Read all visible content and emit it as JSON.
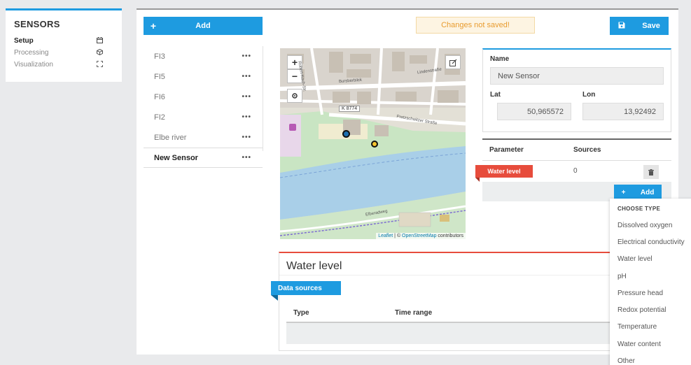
{
  "nav": {
    "title": "SENSORS",
    "items": [
      {
        "label": "Setup",
        "icon": "calendar-icon",
        "active": true
      },
      {
        "label": "Processing",
        "icon": "cube-icon",
        "active": false
      },
      {
        "label": "Visualization",
        "icon": "expand-icon",
        "active": false
      }
    ]
  },
  "toolbar": {
    "add_label": "Add",
    "unsaved_text": "Changes not saved!",
    "save_label": "Save"
  },
  "sensors": [
    {
      "name": "FI3",
      "more": "•••"
    },
    {
      "name": "FI5",
      "more": "•••"
    },
    {
      "name": "FI6",
      "more": "•••"
    },
    {
      "name": "FI2",
      "more": "•••"
    },
    {
      "name": "Elbe river",
      "more": "•••"
    },
    {
      "name": "New Sensor",
      "more": "•••"
    }
  ],
  "map": {
    "zoom_in": "+",
    "zoom_out": "−",
    "road_label": "K 8774",
    "streets": [
      "Lindenstraße",
      "Bursberbilck",
      "Pratzschwitzer Straße",
      "Elberadweg",
      "Robert-Koch-Str."
    ],
    "attribution_leaflet": "Leaflet",
    "attribution_sep": " | © ",
    "attribution_osm": "OpenStreetMap",
    "attribution_tail": " contributors"
  },
  "details": {
    "name_label": "Name",
    "name_value": "New Sensor",
    "lat_label": "Lat",
    "lat_value": "50,965572",
    "lon_label": "Lon",
    "lon_value": "13,92492"
  },
  "parameters": {
    "col_parameter": "Parameter",
    "col_sources": "Sources",
    "rows": [
      {
        "name": "Water level",
        "sources": "0"
      }
    ],
    "add_label": "Add"
  },
  "water_level": {
    "title": "Water level",
    "badge": "Data sources",
    "col_type": "Type",
    "col_time_range": "Time range"
  },
  "dropdown": {
    "header": "CHOOSE TYPE",
    "options": [
      "Dissolved oxygen",
      "Electrical conductivity",
      "Water level",
      "pH",
      "Pressure head",
      "Redox potential",
      "Temperature",
      "Water content",
      "Other"
    ]
  },
  "colors": {
    "accent": "#1e9be0",
    "danger": "#e74c3c",
    "warning_text": "#e89b2e"
  }
}
